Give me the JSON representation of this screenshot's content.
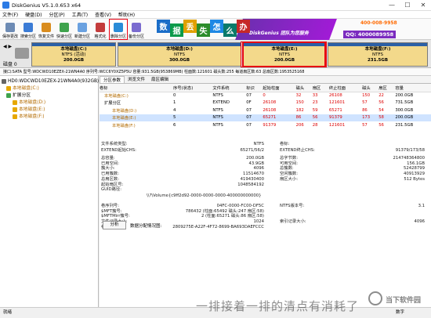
{
  "window": {
    "title": "DiskGenius V5.1.0.653 x64",
    "min": "—",
    "max": "☐",
    "close": "✕"
  },
  "menu": [
    "文件(F)",
    "硬盘(D)",
    "分区(P)",
    "工具(T)",
    "查看(V)",
    "帮助(H)"
  ],
  "toolbar": [
    {
      "label": "保存更改",
      "icon": "save-icon",
      "color": "#6d8bb4"
    },
    {
      "label": "搜索分区",
      "icon": "search-icon",
      "color": "#3a7bd5"
    },
    {
      "label": "恢复文件",
      "icon": "recover-icon",
      "color": "#d98c1e"
    },
    {
      "label": "快速分区",
      "icon": "quick-partition-icon",
      "color": "#3fa34d"
    },
    {
      "label": "新建分区",
      "icon": "new-partition-icon",
      "color": "#6aa1e0"
    },
    {
      "label": "格式化",
      "icon": "format-icon",
      "color": "#c33b3b"
    },
    {
      "label": "删除分区",
      "icon": "delete-icon",
      "color": "#2a8cd8",
      "highlighted": true
    },
    {
      "label": "备份分区",
      "icon": "backup-icon",
      "color": "#7a6bcf"
    }
  ],
  "banner": {
    "chars": [
      "数",
      "据",
      "丢",
      "失",
      "怎",
      "么",
      "办"
    ],
    "colors": [
      "#1a6dc8",
      "#0a9a4a",
      "#e0a000",
      "#2b8c2b",
      "#1e88e5",
      "#0a7a6a",
      "#c62828"
    ],
    "brand": "DiskGenius 团队为您服务",
    "qq": "QQ: 4000089958",
    "phone": "400-008-9958"
  },
  "disk": {
    "nav": "◀ ▶",
    "label": "磁盘 0",
    "partitions": [
      {
        "name": "本地磁盘(C:)",
        "fs": "NTFS (活动)",
        "size": "200.0GB",
        "fill": 0.3
      },
      {
        "name": "本地磁盘(D:)",
        "fs": "NTFS",
        "size": "300.0GB",
        "fill": 0.3
      },
      {
        "name": "本地磁盘(E:)",
        "fs": "NTFS",
        "size": "200.0GB",
        "fill": 0.2
      },
      {
        "name": "本地磁盘(F:)",
        "fs": "NTFS",
        "size": "231.5GB",
        "fill": 0.3
      }
    ]
  },
  "infoline": "接口:SATA  型号:WDCWD10EZEX-21WN4A0  序列号:WCC6Y0XZ5P5U  容量:931.5GB(953869MB)  柱面数:121601  磁头数:255  每道扇区数:63  总扇区数:1953525168",
  "tree": [
    {
      "label": "HD0:WDCWD10EZEX-21WN4A0(932GB)",
      "color": "#666",
      "indent": 0,
      "cls": ""
    },
    {
      "label": "本地磁盘(C:)",
      "color": "#e6a800",
      "indent": 6,
      "cls": "orange"
    },
    {
      "label": "扩展分区",
      "color": "#3fa34d",
      "indent": 6,
      "cls": ""
    },
    {
      "label": "本地磁盘(D:)",
      "color": "#e6a800",
      "indent": 14,
      "cls": "orange"
    },
    {
      "label": "本地磁盘(E:)",
      "color": "#e6a800",
      "indent": 14,
      "cls": "orange"
    },
    {
      "label": "本地磁盘(F:)",
      "color": "#e6a800",
      "indent": 14,
      "cls": "orange"
    }
  ],
  "tabs": [
    "分区参数",
    "浏览文件",
    "扇区编辑"
  ],
  "table": {
    "headers": [
      "卷标",
      "序号(状态)",
      "文件系统",
      "标识",
      "起始柱面",
      "磁头",
      "扇区",
      "终止柱面",
      "磁头",
      "扇区",
      "容量"
    ],
    "rows": [
      [
        "本地磁盘(C:)",
        "0",
        "NTFS",
        "07",
        "0",
        "32",
        "33",
        "26108",
        "150",
        "22",
        "200.0GB"
      ],
      [
        "扩展分区",
        "1",
        "EXTEND",
        "0F",
        "26108",
        "150",
        "23",
        "121601",
        "57",
        "56",
        "731.5GB"
      ],
      [
        "本地磁盘(D:)",
        "4",
        "NTFS",
        "07",
        "26108",
        "182",
        "59",
        "65271",
        "86",
        "54",
        "300.0GB"
      ],
      [
        "本地磁盘(E:)",
        "5",
        "NTFS",
        "07",
        "65271",
        "86",
        "56",
        "91379",
        "173",
        "58",
        "200.0GB"
      ],
      [
        "本地磁盘(F:)",
        "6",
        "NTFS",
        "07",
        "91379",
        "206",
        "28",
        "121601",
        "57",
        "56",
        "231.5GB"
      ]
    ],
    "selected": 3
  },
  "details": {
    "fs_type_label": "文件系统类型:",
    "fs_type": "NTFS",
    "vol_label": "卷标:",
    "ext_start_label": "EXTEND起始CHS:",
    "ext_start": "65271/56/2",
    "ext_end_label": "EXTEND终止CHS:",
    "ext_end": "91379/173/58",
    "left_labels": [
      "总容量:",
      "已用空间:",
      "簇大小:",
      "已用簇数:",
      "总扇区数:",
      "起始扇区号:",
      "GUID路径:"
    ],
    "left_values": [
      "200.0GB",
      "43.9GB",
      "4096",
      "11514670",
      "419430400",
      "1048584192",
      ""
    ],
    "right_labels": [
      "总字节数:",
      "可用空间:",
      "总簇数:",
      "空闲簇数:",
      "扇区大小:",
      ""
    ],
    "right_values": [
      "214748364800",
      "156.1GB",
      "52428799",
      "40913929",
      "512 Bytes",
      ""
    ],
    "guid_path": "\\\\?\\Volume{c9ff2d92-0000-0000-0000-400000000000}",
    "bottom_left_labels": [
      "卷序列号:",
      "$MFT簇号:",
      "$MFTMirr簇号:",
      "文件记录大小:",
      "卷GUID:"
    ],
    "bottom_left_values": [
      "04FC-0000-FC00-DF5C",
      "786432 (柱面:65492 磁头:247 扇区:58)",
      "2 (柱面:65271 磁头:86 扇区:58)",
      "1024",
      "2809275E-A22F-4F72-8699-BA693DAEFCCC"
    ],
    "bottom_right_labels": [
      "NTFS版本号:",
      "",
      "",
      "索引记录大小:"
    ],
    "bottom_right_values": [
      "3.1",
      "",
      "",
      "4096"
    ]
  },
  "analyze": {
    "button": "分析",
    "label": "数据分配情况图:"
  },
  "status": {
    "left": "就绪",
    "right": "数字"
  },
  "watermark": "一排接着一排的清点有消耗了",
  "logo": "当下软件园"
}
